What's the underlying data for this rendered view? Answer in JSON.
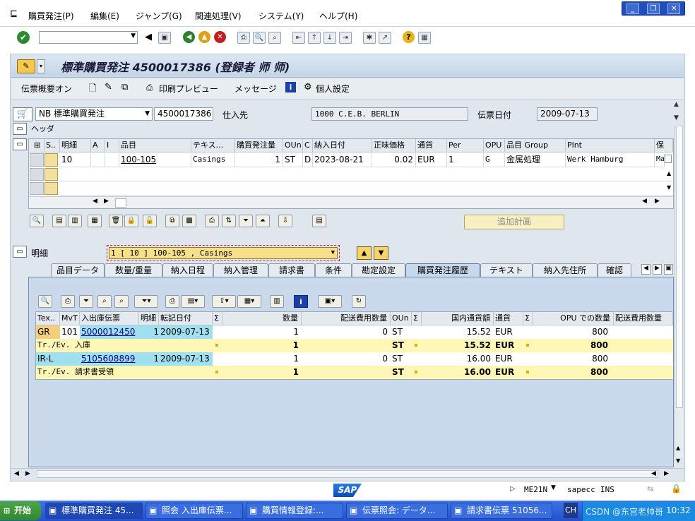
{
  "window": {
    "menus": [
      "購買発注(P)",
      "編集(E)",
      "ジャンプ(G)",
      "関連処理(V)",
      "システム(Y)",
      "ヘルプ(H)"
    ]
  },
  "header": {
    "title": "標準購買発注 4500017386 (登録者 师 师)"
  },
  "appbar": {
    "buttons": [
      "伝票概要オン",
      "印刷プレビュー",
      "メッセージ",
      "個人設定"
    ]
  },
  "doc": {
    "doc_type": "NB 標準購買発注",
    "doc_number": "4500017386",
    "vendor_label": "仕入先",
    "vendor_value": "1000 C.E.B. BERLIN",
    "date_label": "伝票日付",
    "date_value": "2009-07-13",
    "header_label": "ヘッダ"
  },
  "items": {
    "columns": [
      "S..",
      "明細",
      "A",
      "I",
      "品目",
      "テキス...",
      "購買発注量",
      "OUn",
      "C",
      "納入日付",
      "正味価格",
      "通貨",
      "Per",
      "OPU",
      "品目 Group",
      "Plnt",
      "保"
    ],
    "row": {
      "item": "10",
      "material": "100-105",
      "text": "Casings",
      "qty": "1",
      "oun": "ST",
      "c": "D",
      "date": "2023-08-21",
      "price": "0.02",
      "currency": "EUR",
      "per": "1",
      "opu": "G",
      "group": "金属処理",
      "plant": "Werk Hamburg",
      "extra": "Ma"
    },
    "add_plan_label": "追加計画"
  },
  "detail": {
    "label": "明細",
    "selected": "1 [ 10 ] 100-105 , Casings"
  },
  "tabs": [
    "品目データ",
    "数量/重量",
    "納入日程",
    "納入管理",
    "請求書",
    "条件",
    "勘定設定",
    "購買発注履歴",
    "テキスト",
    "納入先住所",
    "確認"
  ],
  "history": {
    "columns": [
      "Tex..",
      "MvT",
      "入出庫伝票",
      "明細",
      "転記日付",
      "Σ",
      "数量",
      "配送費用数量",
      "OUn",
      "Σ",
      "国内通貨額",
      "通貨",
      "Σ",
      "OPU での数量",
      "配送費用数量"
    ],
    "rows": [
      {
        "tex": "GR",
        "mvt": "101",
        "doc": "5000012450",
        "item": "1",
        "date": "2009-07-13",
        "qty": "1",
        "dc": "0",
        "oun": "ST",
        "amt": "15.52",
        "cur": "EUR",
        "opu": "800",
        "kind": "data"
      },
      {
        "tex": "Tr./Ev. 入庫",
        "qty": "1",
        "oun": "ST",
        "amt": "15.52",
        "cur": "EUR",
        "opu": "800",
        "kind": "sum"
      },
      {
        "tex": "IR-L",
        "mvt": "",
        "doc": "5105608899",
        "item": "1",
        "date": "2009-07-13",
        "qty": "1",
        "dc": "0",
        "oun": "ST",
        "amt": "16.00",
        "cur": "EUR",
        "opu": "800",
        "kind": "data"
      },
      {
        "tex": "Tr./Ev. 請求書受領",
        "qty": "1",
        "oun": "ST",
        "amt": "16.00",
        "cur": "EUR",
        "opu": "800",
        "kind": "sum"
      }
    ]
  },
  "status": {
    "transaction": "ME21N",
    "system": "sapecc",
    "mode": "INS",
    "logo": "SAP"
  },
  "taskbar": {
    "start": "开始",
    "tasks": [
      "標準購買発注 45...",
      "照会 入出庫伝票...",
      "購買情報登録:...",
      "伝票照会: データ...",
      "請求書伝票 51056..."
    ],
    "lang": "CH",
    "watermark": "CSDN @东宫老帅哥",
    "clock": "10:32"
  }
}
